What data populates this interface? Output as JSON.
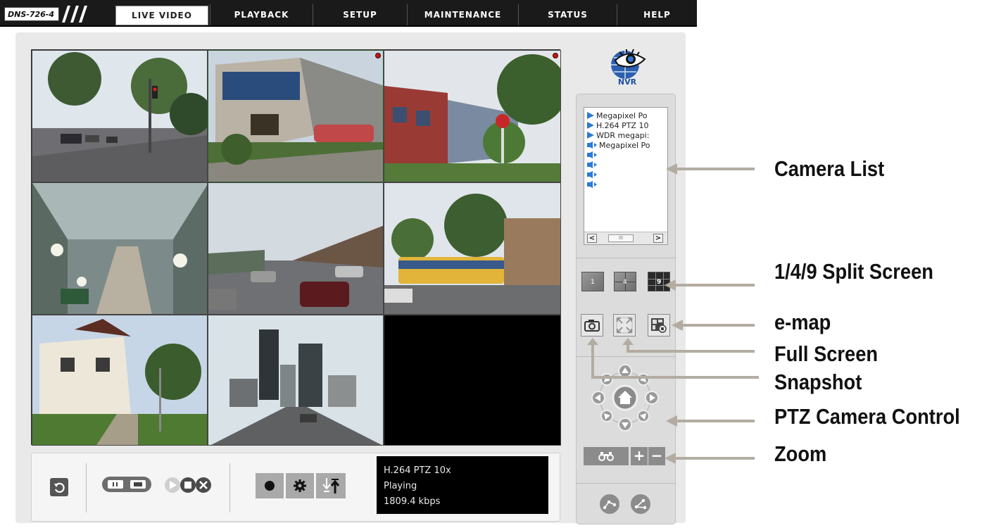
{
  "topnav": {
    "model": "DNS-726-4",
    "tabs": [
      {
        "label": "LIVE VIDEO",
        "active": true
      },
      {
        "label": "PLAYBACK",
        "active": false
      },
      {
        "label": "SETUP",
        "active": false
      },
      {
        "label": "MAINTENANCE",
        "active": false
      },
      {
        "label": "STATUS",
        "active": false
      },
      {
        "label": "HELP",
        "active": false
      }
    ]
  },
  "logo": {
    "text": "NVR"
  },
  "camera_list": {
    "items": [
      {
        "icon": "play-icon",
        "label": "Megapixel Po"
      },
      {
        "icon": "play-icon",
        "label": "H.264 PTZ 10"
      },
      {
        "icon": "play-icon",
        "label": "WDR megapi:"
      },
      {
        "icon": "speaker-icon",
        "label": "Megapixel Po"
      },
      {
        "icon": "speaker-icon",
        "label": ""
      },
      {
        "icon": "speaker-icon",
        "label": ""
      },
      {
        "icon": "speaker-icon",
        "label": ""
      },
      {
        "icon": "speaker-icon",
        "label": ""
      }
    ],
    "scroll_left": "<",
    "scroll_right": ">",
    "scroll_thumb": "III"
  },
  "split_buttons": [
    "1",
    "4",
    "9"
  ],
  "zoom": {
    "plus": "+",
    "minus": "−"
  },
  "status": {
    "camera": "H.264 PTZ 10x",
    "state": "Playing",
    "bitrate": "1809.4 kbps"
  },
  "annotations": {
    "camera_list": "Camera List",
    "split_screen": "1/4/9 Split Screen",
    "emap": "e-map",
    "full_screen": "Full Screen",
    "snapshot": "Snapshot",
    "ptz": "PTZ Camera Control",
    "zoom": "Zoom"
  },
  "colors": {
    "nav_bg": "#1a1a1a",
    "panel_bg": "#dcdcdc",
    "pointer": "#b3aca1",
    "record_dot": "#c01818",
    "list_play": "#2a7bd6"
  }
}
